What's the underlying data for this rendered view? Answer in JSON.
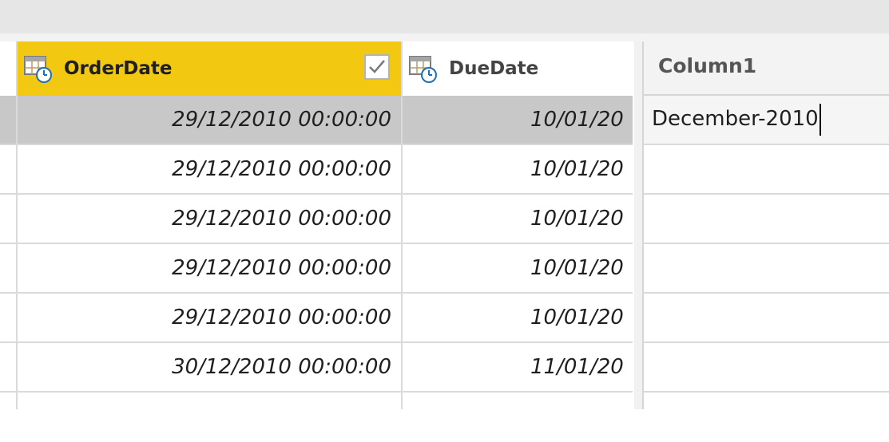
{
  "grid": {
    "columns": [
      {
        "name": "OrderDate",
        "type_icon": "calendar-clock-icon",
        "selected": true,
        "filter_icon": "checkbox-check-icon"
      },
      {
        "name": "DueDate",
        "type_icon": "calendar-clock-icon",
        "selected": false
      }
    ],
    "rows": [
      {
        "order_date": "29/12/2010 00:00:00",
        "due_date": "10/01/20",
        "selected": true
      },
      {
        "order_date": "29/12/2010 00:00:00",
        "due_date": "10/01/20"
      },
      {
        "order_date": "29/12/2010 00:00:00",
        "due_date": "10/01/20"
      },
      {
        "order_date": "29/12/2010 00:00:00",
        "due_date": "10/01/20"
      },
      {
        "order_date": "29/12/2010 00:00:00",
        "due_date": "10/01/20"
      },
      {
        "order_date": "30/12/2010 00:00:00",
        "due_date": "11/01/20"
      }
    ]
  },
  "example_panel": {
    "header": "Column1",
    "cells": [
      "December-2010",
      "",
      "",
      "",
      "",
      ""
    ]
  },
  "colors": {
    "selected_header": "#f2c811",
    "selected_row": "#c8c8c8",
    "grid_lines": "#dadada"
  }
}
